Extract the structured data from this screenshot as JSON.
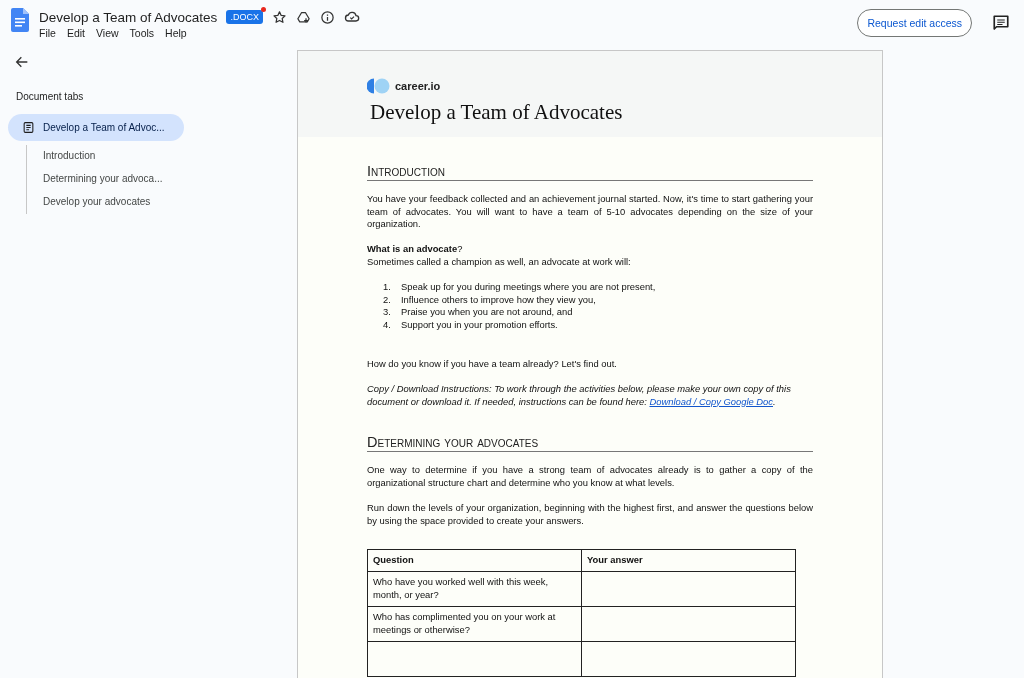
{
  "header": {
    "title": "Develop a Team of Advocates",
    "badge": ".DOCX",
    "menu": [
      "File",
      "Edit",
      "View",
      "Tools",
      "Help"
    ],
    "button": "Request edit access"
  },
  "sidebar": {
    "heading": "Document tabs",
    "tabs": [
      {
        "label": "Develop a Team of Advoc...",
        "selected": true,
        "children": [
          {
            "label": "Introduction",
            "selected": false
          },
          {
            "label": "Determining your advoca...",
            "selected": false
          },
          {
            "label": "Develop your advocates",
            "selected": false
          }
        ]
      }
    ]
  },
  "document": {
    "brand": "career.io",
    "title": "Develop a Team of Advocates",
    "sections": [
      {
        "heading": "Introduction",
        "blocks": [
          {
            "kind": "paragraph",
            "lines": [
              "You have your feedback collected and an achievement journal started. Now, it's time to start gathering your team of advocates. You will want to have a team of 5-10 advocates depending on the size of your organization."
            ]
          },
          {
            "kind": "paragraph",
            "lines": [
              "**What is an advocate**?",
              "Sometimes called a champion as well, an advocate at work will:"
            ]
          },
          {
            "kind": "list",
            "items": [
              {
                "number": "1.",
                "text": "Speak up for you during meetings where you are not present,"
              },
              {
                "number": "2.",
                "text": "Influence others to improve how they view you,"
              },
              {
                "number": "3.",
                "text": "Praise you when you are not around, and"
              },
              {
                "number": "4.",
                "text": "Support you in your promotion efforts."
              }
            ]
          },
          {
            "kind": "paragraph",
            "lines": [
              "How do you know if you have a team already? Let's find out."
            ]
          },
          {
            "kind": "note",
            "text": "Copy / Download Instructions: To work through the activities below, please make your own copy of this document or download it. If needed, instructions can be found here:",
            "link": "Download / Copy Google Doc",
            "after": "."
          }
        ]
      },
      {
        "heading": "Determining your advocates",
        "blocks": [
          {
            "kind": "paragraph",
            "lines": [
              "One way to determine if you have a strong team of advocates already is to gather a copy of the organizational structure chart and determine who you know at what levels."
            ]
          },
          {
            "kind": "paragraph",
            "lines": [
              "Run down the levels of your organization, beginning with the highest first, and answer the questions below by using the space provided to create your answers."
            ]
          },
          {
            "kind": "table",
            "columns": [
              "Question",
              "Your answer"
            ],
            "rows": [
              {
                "question": "Who have you worked well with this week, month, or year?"
              },
              {
                "question": "Who has complimented you on your work at meetings or otherwise?"
              }
            ]
          }
        ]
      }
    ]
  }
}
